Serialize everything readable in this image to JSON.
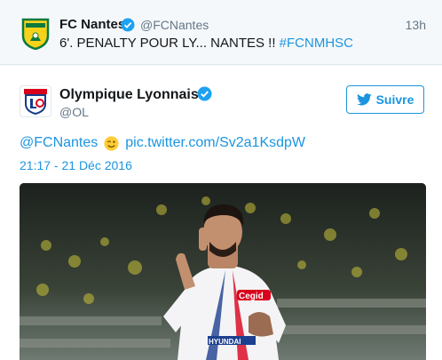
{
  "quoted_tweet": {
    "display_name": "FC Nantes",
    "handle": "@FCNantes",
    "time": "13h",
    "text": "6'. PENALTY POUR LY... NANTES !! ",
    "hashtag": "#FCNMHSC",
    "avatar_icon": "fc-nantes-crest-icon"
  },
  "tweet": {
    "display_name": "Olympique Lyonnais",
    "handle": "@OL",
    "follow_label": "Suivre",
    "mention": "@FCNantes",
    "emoji": "winking-face-emoji",
    "link": "pic.twitter.com/Sv2a1KsdpW",
    "date": "21:17 - 21 Déc 2016",
    "avatar_icon": "olympique-lyonnais-crest-icon",
    "photo_description_icon": "player-celebration-photo",
    "player_name_on_shirt": "Cegid",
    "shirt_sponsor_bottom": "HYUNDAI"
  },
  "colors": {
    "link": "#1b95e0",
    "muted": "#657786",
    "verified": "#1da1f2"
  }
}
